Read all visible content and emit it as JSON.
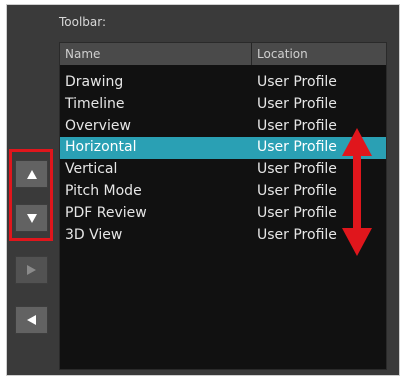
{
  "panel": {
    "toolbar_label": "Toolbar:"
  },
  "list": {
    "columns": {
      "name": "Name",
      "location": "Location"
    },
    "rows": [
      {
        "name": "Drawing",
        "location": "User Profile"
      },
      {
        "name": "Timeline",
        "location": "User Profile"
      },
      {
        "name": "Overview",
        "location": "User Profile"
      },
      {
        "name": "Horizontal",
        "location": "User Profile"
      },
      {
        "name": "Vertical",
        "location": "User Profile"
      },
      {
        "name": "Pitch Mode",
        "location": "User Profile"
      },
      {
        "name": "PDF Review",
        "location": "User Profile"
      },
      {
        "name": "3D View",
        "location": "User Profile"
      }
    ],
    "selected_index": 3
  },
  "side_buttons": {
    "move_up_icon": "triangle-up-icon",
    "move_down_icon": "triangle-down-icon",
    "add_icon": "triangle-right-icon",
    "remove_icon": "triangle-left-icon"
  },
  "colors": {
    "selection": "#2aa0b4",
    "annotation": "#e0161c",
    "list_background": "#111111",
    "panel_background": "#3a3a3a"
  }
}
